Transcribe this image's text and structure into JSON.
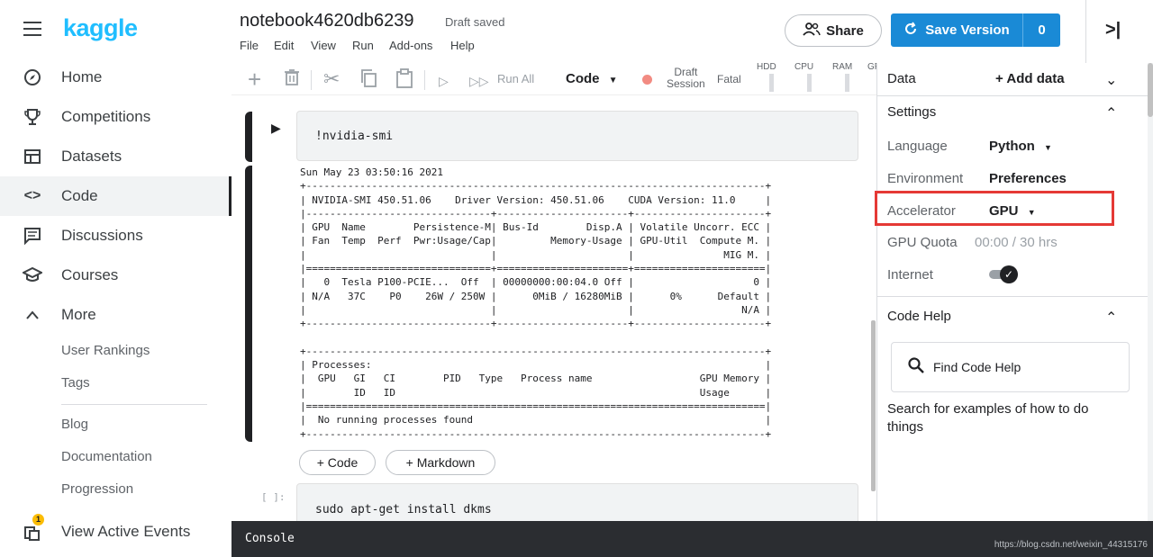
{
  "sidebar": {
    "logo": "kaggle",
    "items": [
      {
        "label": "Home",
        "icon": "compass-icon"
      },
      {
        "label": "Competitions",
        "icon": "trophy-icon"
      },
      {
        "label": "Datasets",
        "icon": "table-icon"
      },
      {
        "label": "Code",
        "icon": "code-icon",
        "active": true
      },
      {
        "label": "Discussions",
        "icon": "chat-icon"
      },
      {
        "label": "Courses",
        "icon": "graduation-cap-icon"
      },
      {
        "label": "More",
        "icon": "chevron-up-icon"
      }
    ],
    "more_items": [
      "User Rankings",
      "Tags",
      "Blog",
      "Documentation",
      "Progression"
    ],
    "events": {
      "label": "View Active Events",
      "badge": "1"
    }
  },
  "header": {
    "title": "notebook4620db6239",
    "status": "Draft saved",
    "menu": [
      "File",
      "Edit",
      "View",
      "Run",
      "Add-ons",
      "Help"
    ],
    "share_label": "Share",
    "save_label": "Save Version",
    "save_count": "0"
  },
  "toolbar": {
    "run_all": "Run All",
    "cell_type": "Code",
    "session_line1": "Draft",
    "session_line2": "Session",
    "session_status": "Fatal",
    "meters": [
      "HDD",
      "CPU",
      "RAM",
      "GPU"
    ]
  },
  "notebook": {
    "cell1_code": "!nvidia-smi",
    "cell1_output": "Sun May 23 03:50:16 2021\n+-----------------------------------------------------------------------------+\n| NVIDIA-SMI 450.51.06    Driver Version: 450.51.06    CUDA Version: 11.0     |\n|-------------------------------+----------------------+----------------------+\n| GPU  Name        Persistence-M| Bus-Id        Disp.A | Volatile Uncorr. ECC |\n| Fan  Temp  Perf  Pwr:Usage/Cap|         Memory-Usage | GPU-Util  Compute M. |\n|                               |                      |               MIG M. |\n|===============================+======================+======================|\n|   0  Tesla P100-PCIE...  Off  | 00000000:00:04.0 Off |                    0 |\n| N/A   37C    P0    26W / 250W |      0MiB / 16280MiB |      0%      Default |\n|                               |                      |                  N/A |\n+-------------------------------+----------------------+----------------------+\n\n+-----------------------------------------------------------------------------+\n| Processes:                                                                  |\n|  GPU   GI   CI        PID   Type   Process name                  GPU Memory |\n|        ID   ID                                                   Usage      |\n|=============================================================================|\n|  No running processes found                                                 |\n+-----------------------------------------------------------------------------+",
    "add_code": "+ Code",
    "add_markdown": "+ Markdown",
    "cell2_prompt": "[ ]:",
    "cell2_code": "sudo apt-get install dkms"
  },
  "panel": {
    "data_label": "Data",
    "add_data": "+ Add data",
    "settings_label": "Settings",
    "language_label": "Language",
    "language_value": "Python",
    "environment_label": "Environment",
    "environment_value": "Preferences",
    "accelerator_label": "Accelerator",
    "accelerator_value": "GPU",
    "gpu_quota_label": "GPU Quota",
    "gpu_quota_value": "00:00 / 30 hrs",
    "internet_label": "Internet",
    "internet_on": true,
    "code_help_label": "Code Help",
    "find_code_help": "Find Code Help",
    "help_description": "Search for examples of how to do things"
  },
  "console": {
    "label": "Console",
    "watermark": "https://blog.csdn.net/weixin_44315176"
  },
  "colors": {
    "brand": "#20beff",
    "save_button": "#1a8ad6",
    "highlight": "#e53935"
  }
}
